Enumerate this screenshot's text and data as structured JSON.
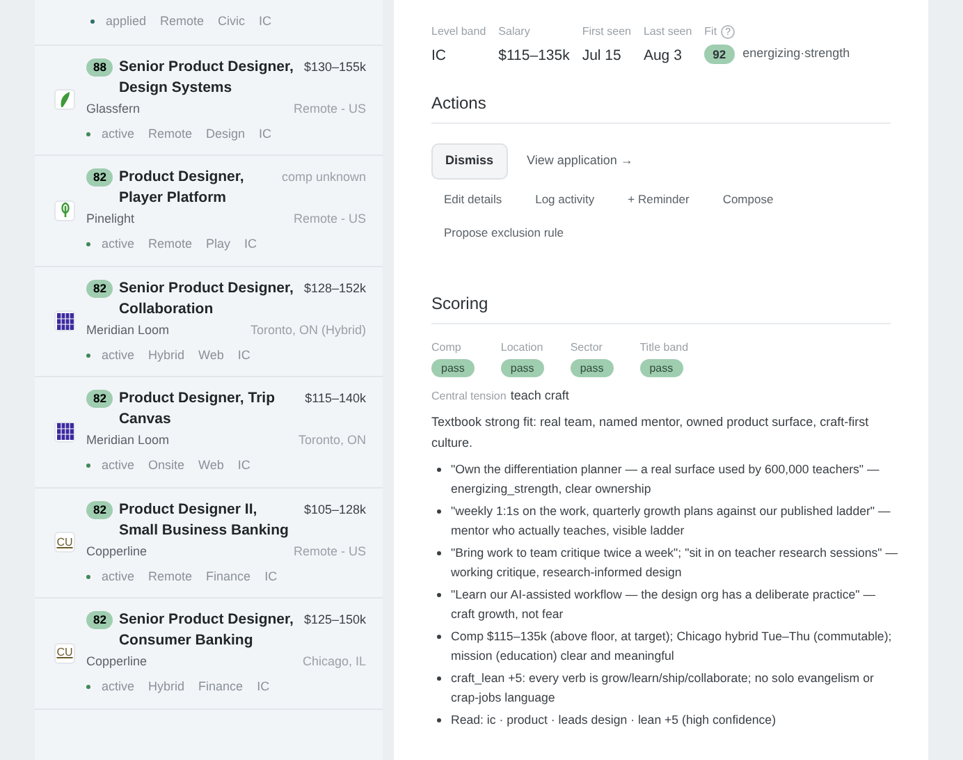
{
  "jobs": [
    {
      "status": "applied",
      "tags": [
        "Remote",
        "Civic",
        "IC"
      ]
    },
    {
      "fit": "88",
      "title": "Senior Product Designer, Design Systems",
      "salary": "$130–155k",
      "company": "Glassfern",
      "location": "Remote - US",
      "logo": {
        "kind": "leaf"
      },
      "status": "active",
      "tags": [
        "Remote",
        "Design",
        "IC"
      ]
    },
    {
      "fit": "82",
      "title": "Product Designer, Player Platform",
      "salary": "comp unknown",
      "company": "Pinelight",
      "location": "Remote - US",
      "logo": {
        "kind": "tree"
      },
      "status": "active",
      "tags": [
        "Remote",
        "Play",
        "IC"
      ]
    },
    {
      "fit": "82",
      "title": "Senior Product Designer, Collaboration",
      "salary": "$128–152k",
      "company": "Meridian Loom",
      "location": "Toronto, ON (Hybrid)",
      "logo": {
        "kind": "grid"
      },
      "status": "active",
      "tags": [
        "Hybrid",
        "Web",
        "IC"
      ]
    },
    {
      "fit": "82",
      "title": "Product Designer, Trip Canvas",
      "salary": "$115–140k",
      "company": "Meridian Loom",
      "location": "Toronto, ON",
      "logo": {
        "kind": "grid"
      },
      "status": "active",
      "tags": [
        "Onsite",
        "Web",
        "IC"
      ]
    },
    {
      "fit": "82",
      "title": "Product Designer II, Small Business Banking",
      "salary": "$105–128k",
      "company": "Copperline",
      "location": "Remote - US",
      "logo": {
        "kind": "letters",
        "text": "CU"
      },
      "status": "active",
      "tags": [
        "Remote",
        "Finance",
        "IC"
      ]
    },
    {
      "fit": "82",
      "title": "Senior Product Designer, Consumer Banking",
      "salary": "$125–150k",
      "company": "Copperline",
      "location": "Chicago, IL",
      "logo": {
        "kind": "letters",
        "text": "CU"
      },
      "status": "active",
      "tags": [
        "Hybrid",
        "Finance",
        "IC"
      ]
    }
  ],
  "detail": {
    "facts": [
      {
        "label": "Level band",
        "value": "IC"
      },
      {
        "label": "Salary",
        "value": "$115–135k"
      },
      {
        "label": "First seen",
        "value": "Jul 15"
      },
      {
        "label": "Last seen",
        "value": "Aug 3"
      }
    ],
    "fit": {
      "label": "Fit",
      "help": "?",
      "score": "92",
      "note": "energizing·strength"
    },
    "actions_title": "Actions",
    "primary_actions": [
      {
        "label": "Dismiss",
        "kind": "outlined"
      },
      {
        "label": "View application →",
        "kind": "link"
      }
    ],
    "secondary_actions": [
      "Edit details",
      "Log activity",
      "+ Reminder",
      "Compose",
      "Propose exclusion rule"
    ],
    "scoring_title": "Scoring",
    "checks": [
      {
        "label": "Comp",
        "result": "pass"
      },
      {
        "label": "Location",
        "result": "pass"
      },
      {
        "label": "Sector",
        "result": "pass"
      },
      {
        "label": "Title band",
        "result": "pass"
      }
    ],
    "tension": {
      "label": "Central tension",
      "value": "teach craft"
    },
    "summary": "Textbook strong fit: real team, named mentor, owned product surface, craft-first culture.",
    "bullets": [
      "\"Own the differentiation planner — a real surface used by 600,000 teachers\" — energizing_strength, clear ownership",
      "\"weekly 1:1s on the work, quarterly growth plans against our published ladder\" — mentor who actually teaches, visible ladder",
      "\"Bring work to team critique twice a week\"; \"sit in on teacher research sessions\" — working critique, research-informed design",
      "\"Learn our AI-assisted workflow — the design org has a deliberate practice\" — craft growth, not fear",
      "Comp $115–135k (above floor, at target); Chicago hybrid Tue–Thu (commutable); mission (education) clear and meaningful",
      "craft_lean +5: every verb is grow/learn/ship/collaborate; no solo evangelism or crap-jobs language",
      "Read: ic · product · leads design · lean +5 (high confidence)"
    ]
  }
}
